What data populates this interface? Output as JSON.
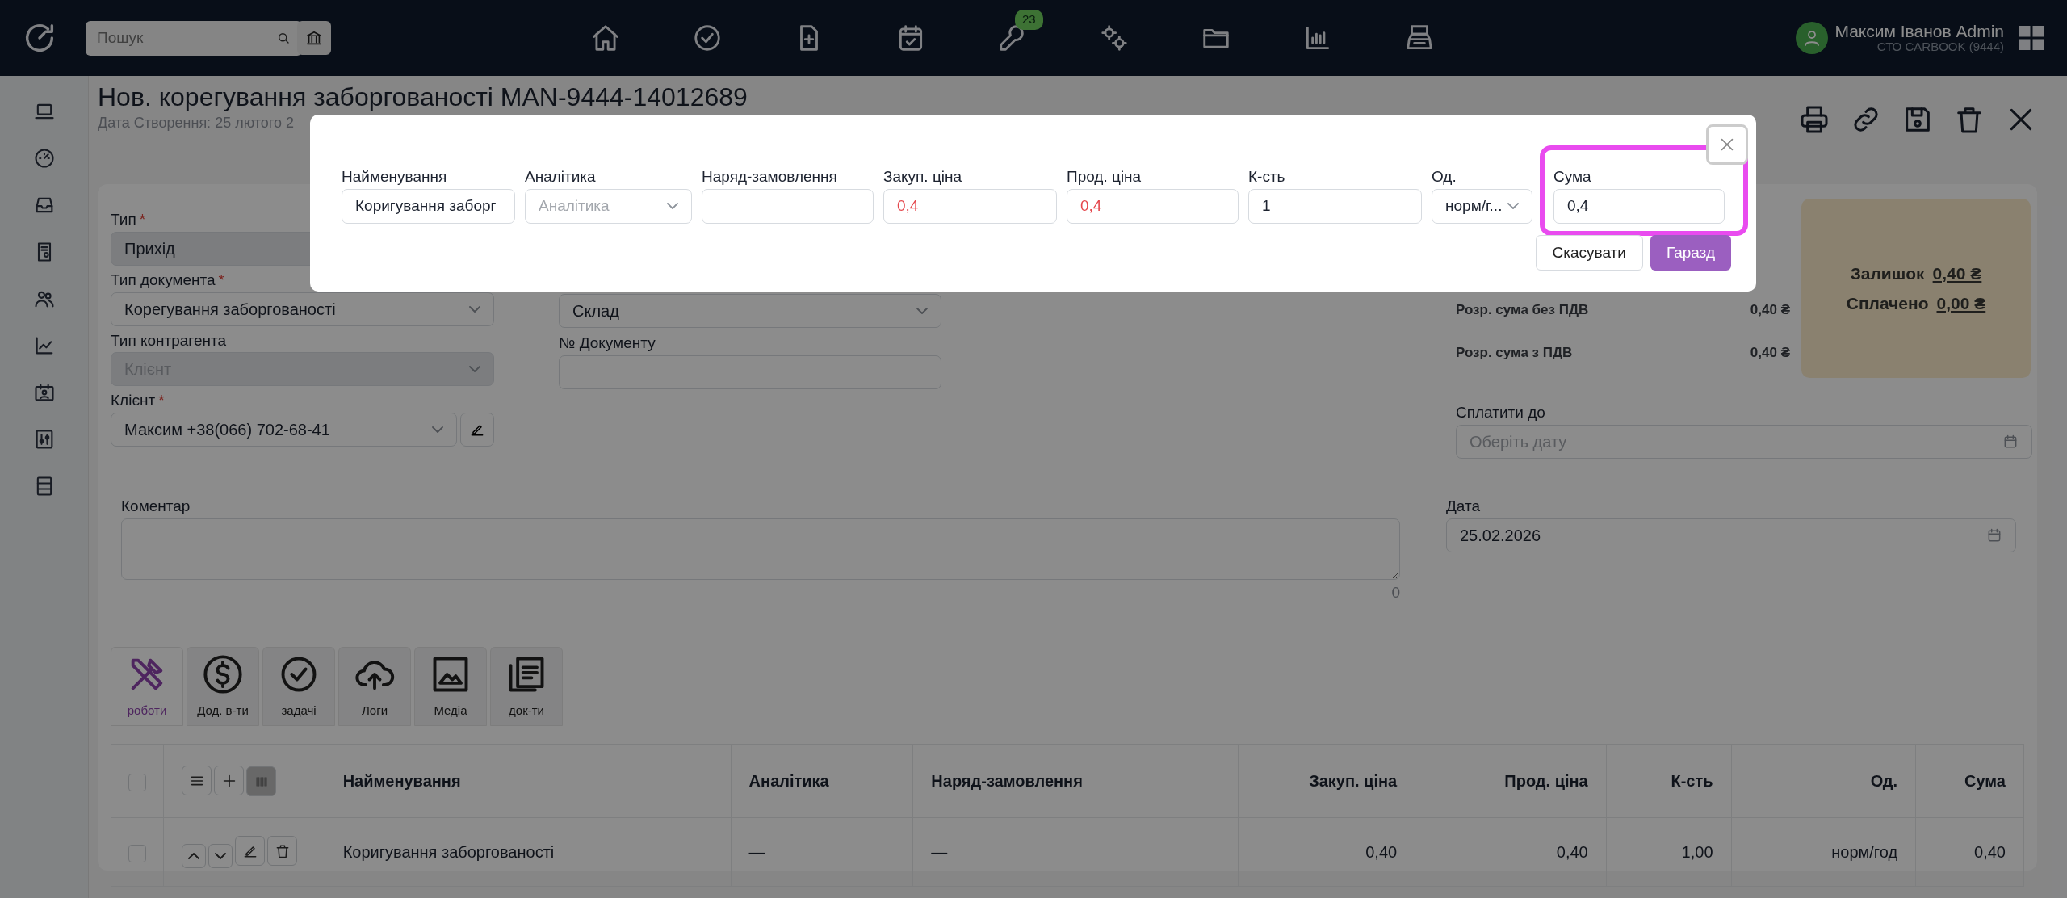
{
  "navbar": {
    "search": {
      "placeholder": "Пошук"
    },
    "badge": "23",
    "user": {
      "name": "Максим Іванов Admin",
      "company": "СТО CARBOOK (9444)"
    }
  },
  "page": {
    "title": "Нов. корегування заборгованості MAN-9444-14012689",
    "created": "Дата Створення: 25 лютого 2"
  },
  "left_fields": [
    {
      "label": "Тип",
      "required": "*",
      "value": "Прихід",
      "disabled": true
    },
    {
      "label": "Тип документа",
      "required": "*",
      "value": "Корегування заборгованості",
      "disabled": false
    },
    {
      "label": "Тип контрагента",
      "placeholder": "Клієнт",
      "disabled": true
    },
    {
      "label": "Клієнт",
      "required": "*",
      "value": "Максим +38(066) 702-68-41",
      "disabled": false
    }
  ],
  "middle_fields": [
    {
      "kind": "select",
      "value": "Склад"
    },
    {
      "kind": "input",
      "label": "№ Документу"
    }
  ],
  "summary": {
    "rows": [
      {
        "label": "Розр. сума без ПДВ",
        "value": "0,40 ₴"
      },
      {
        "label": "Розр. сума з ПДВ",
        "value": "0,40 ₴"
      }
    ],
    "balance": {
      "label": "Залишок",
      "value": "0,40 ₴"
    },
    "paid": {
      "label": "Сплачено",
      "value": "0,00 ₴"
    }
  },
  "pay_until": {
    "label": "Сплатити до",
    "placeholder": "Оберіть дату"
  },
  "comment": {
    "label": "Коментар",
    "counter": "0"
  },
  "date": {
    "label": "Дата",
    "value": "25.02.2026"
  },
  "tabs": [
    {
      "label": "роботи",
      "selected": true
    },
    {
      "label": "Дод. в-ти",
      "selected": false
    },
    {
      "label": "задачі",
      "selected": false
    },
    {
      "label": "Логи",
      "selected": false
    },
    {
      "label": "Медіа",
      "selected": false
    },
    {
      "label": "док-ти",
      "selected": false
    }
  ],
  "table": {
    "header_checked": false,
    "columns": [
      "Найменування",
      "Аналітика",
      "Наряд-замовлення",
      "Закуп. ціна",
      "Прод. ціна",
      "К-сть",
      "Од.",
      "Сума"
    ],
    "rows": [
      {
        "checked": false,
        "cells": [
          "Коригування заборгованості",
          "—",
          "—",
          "0,40",
          "0,40",
          "1,00",
          "норм/год",
          "0,40"
        ]
      }
    ]
  },
  "modal": {
    "fields": [
      {
        "kind": "input",
        "label": "Найменування",
        "value": "Коригування заборг",
        "error": false
      },
      {
        "kind": "select",
        "label": "Аналітика",
        "placeholder": "Аналітика"
      },
      {
        "kind": "input",
        "label": "Наряд-замовлення"
      },
      {
        "kind": "input",
        "label": "Закуп. ціна",
        "value": "0,4",
        "error": true
      },
      {
        "kind": "input",
        "label": "Прод. ціна",
        "value": "0,4",
        "error": true
      },
      {
        "kind": "input",
        "label": "К-сть",
        "value": "1",
        "error": false
      },
      {
        "kind": "select",
        "label": "Од.",
        "value": "норм/г...",
        "error": false
      },
      {
        "kind": "input",
        "label": "Сума",
        "value": "0,4",
        "error": false,
        "highlighted": true
      }
    ],
    "buttons": [
      {
        "label": "Скасувати",
        "kind": "secondary"
      },
      {
        "label": "Гаразд",
        "kind": "primary"
      }
    ]
  }
}
